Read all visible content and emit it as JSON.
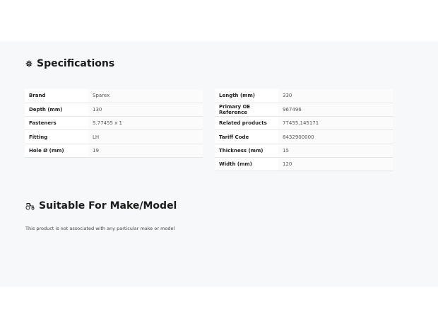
{
  "specifications": {
    "title": "Specifications",
    "left": [
      {
        "label": "Brand",
        "value": "Sparex"
      },
      {
        "label": "Depth (mm)",
        "value": "130"
      },
      {
        "label": "Fasteners",
        "value": "S.77455 x 1"
      },
      {
        "label": "Fitting",
        "value": "LH"
      },
      {
        "label": "Hole Ø (mm)",
        "value": "19"
      }
    ],
    "right": [
      {
        "label": "Length (mm)",
        "value": "330"
      },
      {
        "label": "Primary OE Reference",
        "value": "967496"
      },
      {
        "label": "Related products",
        "value": "77455,145171"
      },
      {
        "label": "Tariff Code",
        "value": "8432900000"
      },
      {
        "label": "Thickness (mm)",
        "value": "15"
      },
      {
        "label": "Width (mm)",
        "value": "120"
      }
    ]
  },
  "suitable": {
    "title": "Suitable For Make/Model",
    "note": "This product is not associated with any particular make or model"
  },
  "icons": {
    "specifications": "gear-icon",
    "suitable": "tractor-icon"
  }
}
